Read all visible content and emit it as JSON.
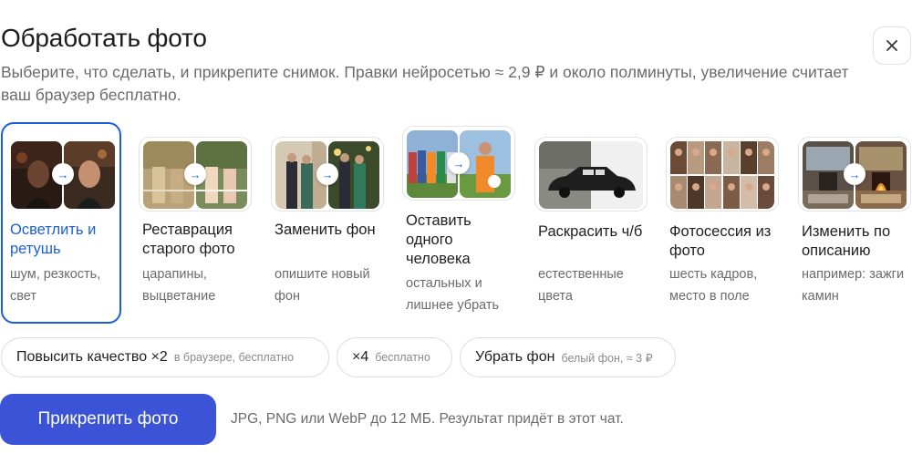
{
  "header": {
    "title": "Обработать фото",
    "subtitle": "Выберите, что сделать, и прикрепите снимок. Правки нейросетью ≈ 2,9 ₽ и около полминуты, увеличение считает ваш браузер бесплатно.",
    "close_icon": "close-icon"
  },
  "cards": [
    {
      "title": "Осветлить и ретушь",
      "desc": "шум, резкость, свет",
      "selected": true
    },
    {
      "title": "Реставрация старого фото",
      "desc": "царапины, выцветание",
      "selected": false
    },
    {
      "title": "Заменить фон",
      "desc": "опишите новый фон",
      "selected": false
    },
    {
      "title": "Оставить одного человека",
      "desc": "остальных и лишнее убрать",
      "selected": false
    },
    {
      "title": "Раскрасить ч/б",
      "desc": "естественные цвета",
      "selected": false
    },
    {
      "title": "Фотосессия из фото",
      "desc": "шесть кадров, место в поле",
      "selected": false
    },
    {
      "title": "Изменить по описанию",
      "desc": "например: зажги камин",
      "selected": false
    }
  ],
  "chips": [
    {
      "label": "Повысить качество ×2",
      "hint": "в браузере, бесплатно"
    },
    {
      "label": "×4",
      "hint": "бесплатно"
    },
    {
      "label": "Убрать фон",
      "hint": "белый фон, ≈ 3 ₽"
    }
  ],
  "cta": {
    "label": "Прикрепить фото",
    "note": "JPG, PNG или WebP до 12 МБ. Результат придёт в этот чат."
  },
  "colors": {
    "accent": "#1a5fd6",
    "button": "#3b53d6",
    "muted_text": "#6b6b6b"
  }
}
